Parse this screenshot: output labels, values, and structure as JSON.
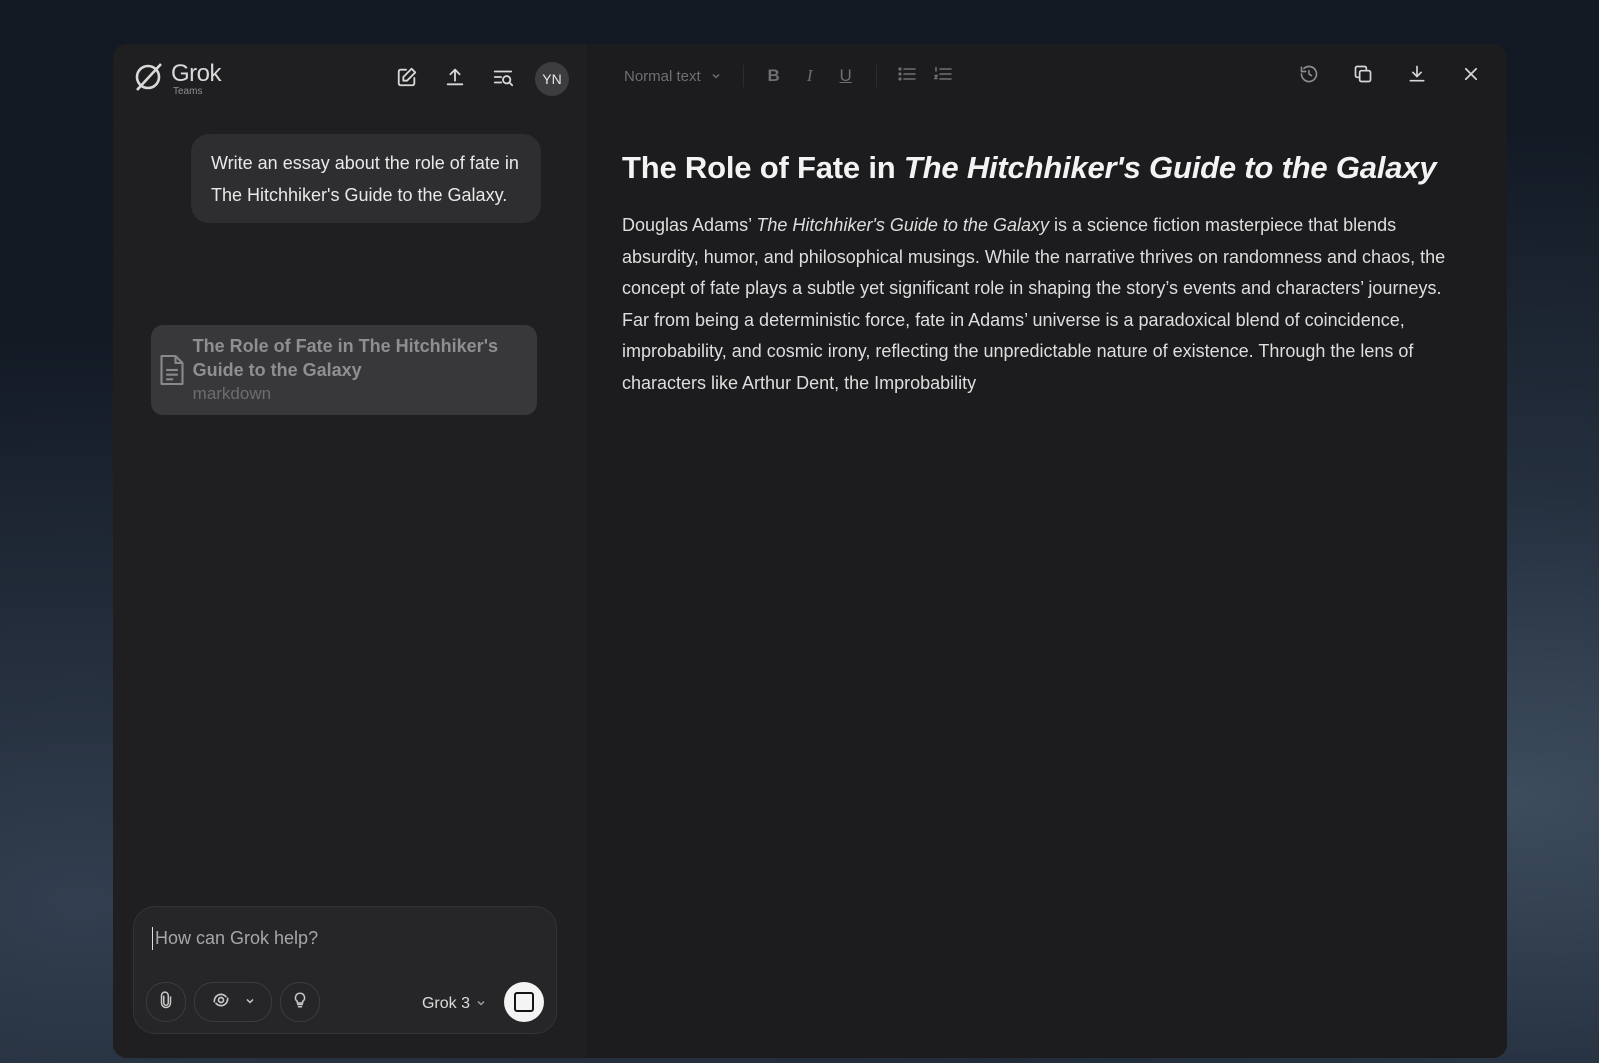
{
  "brand": {
    "name": "Grok",
    "subtitle": "Teams"
  },
  "user": {
    "initials": "YN"
  },
  "chat": {
    "user_message": "Write an essay about the role of fate in The Hitchhiker's Guide to the Galaxy.",
    "artifact": {
      "title": "The Role of Fate in The Hitchhiker's Guide to the Galaxy",
      "type": "markdown"
    }
  },
  "composer": {
    "placeholder": "How can Grok help?",
    "model": "Grok 3"
  },
  "editor": {
    "format": "Normal text",
    "title_prefix": "The Role of Fate in ",
    "title_italic": "The Hitchhiker's Guide to the Galaxy",
    "body_prefix": "Douglas Adams’ ",
    "body_italic": "The Hitchhiker's Guide to the Galaxy",
    "body_text": " is a science fiction masterpiece that blends absurdity, humor, and philosophical musings. While the narrative thrives on randomness and chaos, the concept of fate plays a subtle yet significant role in shaping the story’s events and characters’ journeys. Far from being a deterministic force, fate in Adams’ universe is a paradoxical blend of coincidence, improbability, and cosmic irony, reflecting the unpredictable nature of existence. Through the lens of characters like Arthur Dent, the Improbability"
  },
  "icons": {
    "logo": "grok-logo-icon",
    "new_chat": "edit-icon",
    "share": "upload-icon",
    "search": "search-list-icon",
    "history": "history-icon",
    "copy": "copy-icon",
    "download": "download-icon",
    "close": "close-icon"
  }
}
